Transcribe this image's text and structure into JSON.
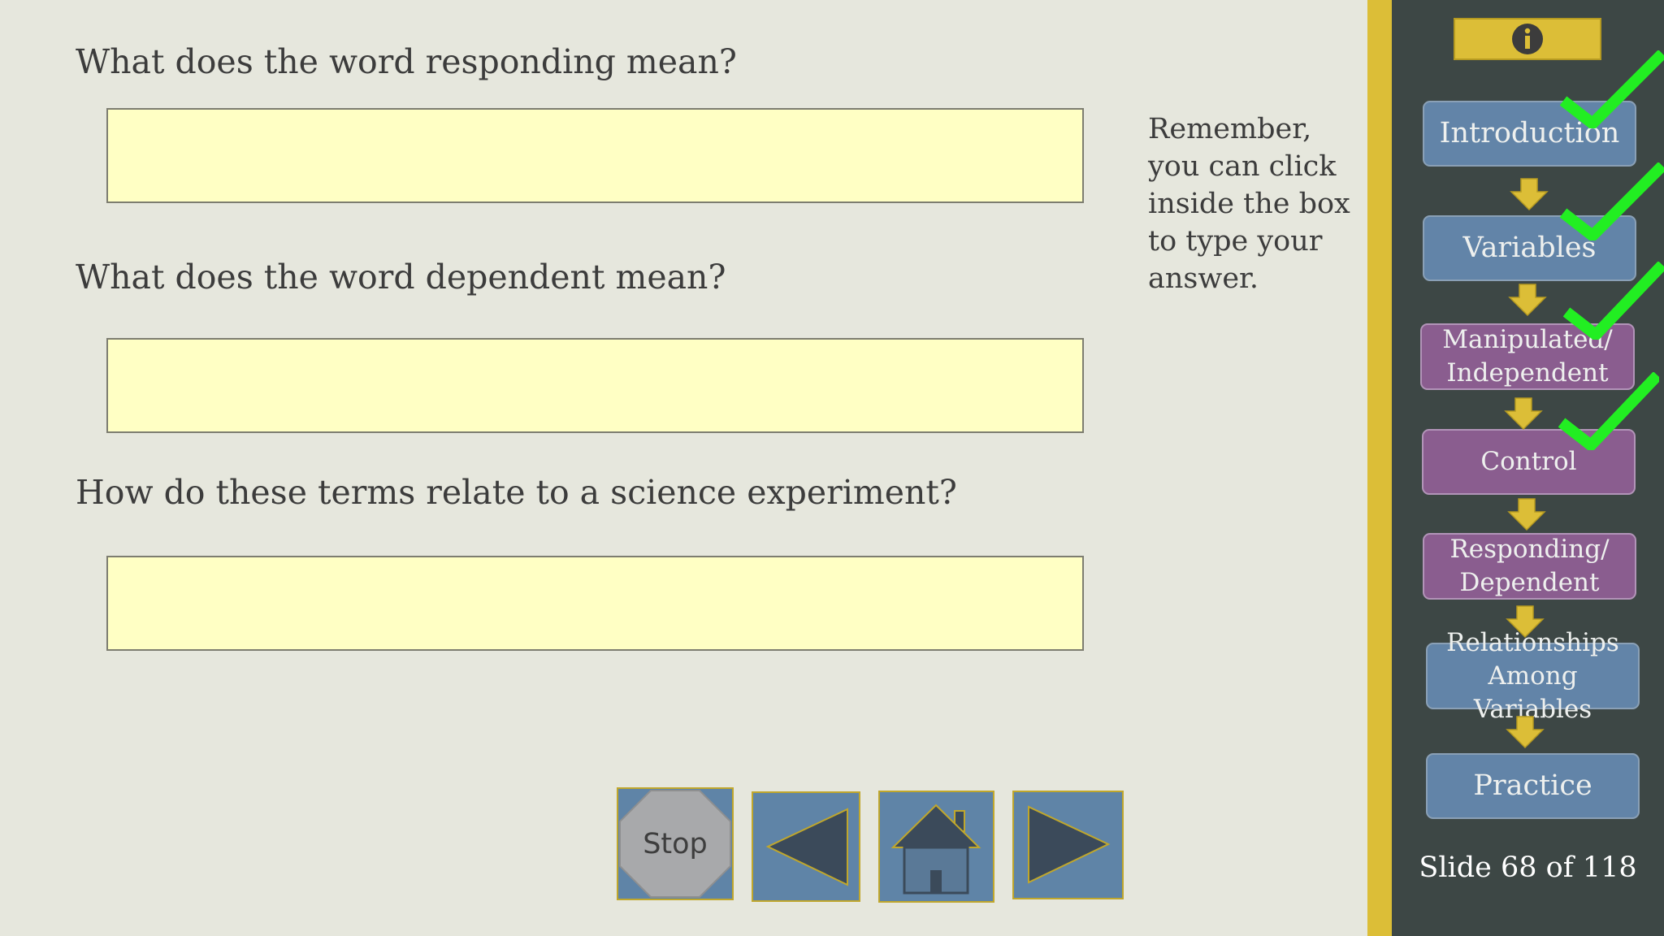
{
  "questions": [
    {
      "text": "What does the word responding mean?",
      "answer": ""
    },
    {
      "text": "What does the word dependent mean?",
      "answer": ""
    },
    {
      "text": "How do these terms relate to a science experiment?",
      "answer": ""
    }
  ],
  "hint": "Remember, you can click inside the box to type your answer.",
  "nav": {
    "stop_label": "Stop",
    "icons": [
      "stop-icon",
      "back-arrow-icon",
      "home-icon",
      "forward-arrow-icon"
    ]
  },
  "sidebar": {
    "info_icon": "info-icon",
    "sections": [
      {
        "label": "Introduction",
        "completed": true
      },
      {
        "label": "Variables",
        "completed": true
      },
      {
        "label": "Manipulated/ Independent",
        "completed": true
      },
      {
        "label": "Control",
        "completed": true
      },
      {
        "label": "Responding/ Dependent",
        "completed": false
      },
      {
        "label": "Relationships Among Variables",
        "completed": false
      },
      {
        "label": "Practice",
        "completed": false
      }
    ],
    "slide_counter": "Slide 68 of 118"
  },
  "colors": {
    "background": "#e6e7dd",
    "answer_box": "#ffffc4",
    "nav_button": "#5f84a7",
    "gold": "#dcbe37",
    "sidebar": "#3d4745",
    "section_blue": "#6284a8",
    "section_purple": "#8a5d8f",
    "check_green": "#22ee22"
  }
}
